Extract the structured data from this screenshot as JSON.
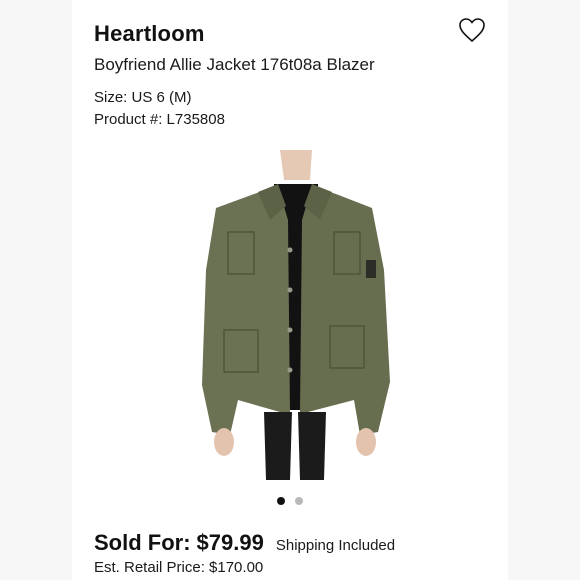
{
  "listing": {
    "brand": "Heartloom",
    "title": "Boyfriend Allie Jacket 176t08a Blazer",
    "size_label": "Size: US 6 (M)",
    "product_label": "Product #: L735808"
  },
  "icons": {
    "favorite": "heart-outline-icon"
  },
  "gallery": {
    "image": "olive green utility jacket worn over black top",
    "dot_count": 2,
    "active_index": 0
  },
  "pricing": {
    "sold_label": "Sold For:",
    "sold_price": "$79.99",
    "shipping": "Shipping Included",
    "retail": "Est. Retail Price: $170.00"
  },
  "colors": {
    "jacket": "#6b7253",
    "accent_text": "#111111"
  }
}
